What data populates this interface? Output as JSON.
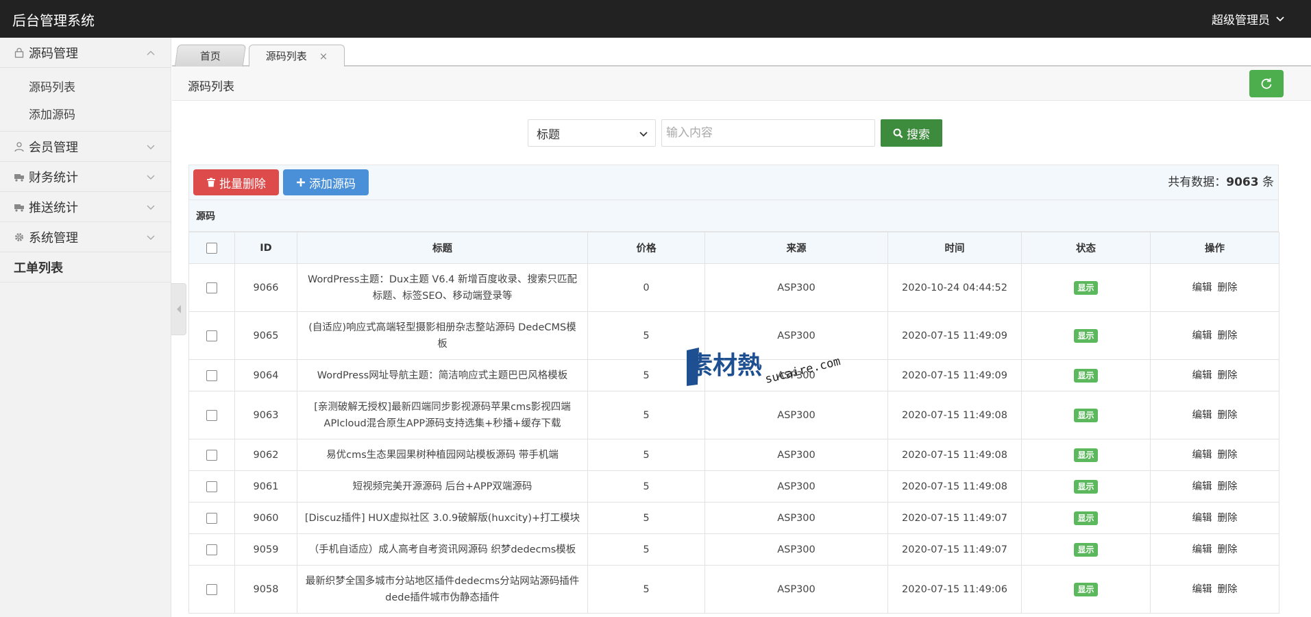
{
  "app": {
    "title": "后台管理系统",
    "user": "超级管理员"
  },
  "sidebar": {
    "groups": [
      {
        "label": "源码管理",
        "icon": "lock-icon",
        "expanded": true,
        "items": [
          "源码列表",
          "添加源码"
        ]
      },
      {
        "label": "会员管理",
        "icon": "user-icon"
      },
      {
        "label": "财务统计",
        "icon": "truck-icon"
      },
      {
        "label": "推送统计",
        "icon": "truck-icon"
      },
      {
        "label": "系统管理",
        "icon": "gear-icon"
      },
      {
        "label": "工单列表"
      }
    ]
  },
  "tabs": {
    "home": "首页",
    "active": "源码列表",
    "close": "×"
  },
  "page": {
    "title": "源码列表"
  },
  "search": {
    "field_selected": "标题",
    "placeholder": "输入内容",
    "button": "搜索"
  },
  "toolbar": {
    "batch_delete": "批量删除",
    "add": "添加源码",
    "total_label": "共有数据：",
    "total_count": "9063",
    "total_unit": " 条"
  },
  "table": {
    "panel_title": "源码",
    "headers": [
      "ID",
      "标题",
      "价格",
      "来源",
      "时间",
      "状态",
      "操作"
    ],
    "edit": "编辑",
    "delete": "删除",
    "rows": [
      {
        "id": "9066",
        "title": "WordPress主题：Dux主题 V6.4 新增百度收录、搜索只匹配标题、标签SEO、移动端登录等",
        "price": "0",
        "source": "ASP300",
        "time": "2020-10-24 04:44:52",
        "status": "显示"
      },
      {
        "id": "9065",
        "title": "(自适应)响应式高端轻型摄影相册杂志整站源码 DedeCMS模板",
        "price": "5",
        "source": "ASP300",
        "time": "2020-07-15 11:49:09",
        "status": "显示"
      },
      {
        "id": "9064",
        "title": "WordPress网址导航主题：简洁响应式主题巴巴风格模板",
        "price": "5",
        "source": "ASP300",
        "time": "2020-07-15 11:49:09",
        "status": "显示"
      },
      {
        "id": "9063",
        "title": "[亲测破解无授权]最新四端同步影视源码苹果cms影视四端APIcloud混合原生APP源码支持选集+秒播+缓存下载",
        "price": "5",
        "source": "ASP300",
        "time": "2020-07-15 11:49:08",
        "status": "显示"
      },
      {
        "id": "9062",
        "title": "易优cms生态果园果树种植园网站模板源码 带手机端",
        "price": "5",
        "source": "ASP300",
        "time": "2020-07-15 11:49:08",
        "status": "显示"
      },
      {
        "id": "9061",
        "title": "短视频完美开源源码 后台+APP双端源码",
        "price": "5",
        "source": "ASP300",
        "time": "2020-07-15 11:49:08",
        "status": "显示"
      },
      {
        "id": "9060",
        "title": "[Discuz插件] HUX虚拟社区 3.0.9破解版(huxcity)+打工模块",
        "price": "5",
        "source": "ASP300",
        "time": "2020-07-15 11:49:07",
        "status": "显示"
      },
      {
        "id": "9059",
        "title": "（手机自适应）成人高考自考资讯网源码 织梦dedecms模板",
        "price": "5",
        "source": "ASP300",
        "time": "2020-07-15 11:49:07",
        "status": "显示"
      },
      {
        "id": "9058",
        "title": "最新织梦全国多城市分站地区插件dedecms分站网站源码插件dede插件城市伪静态插件",
        "price": "5",
        "source": "ASP300",
        "time": "2020-07-15 11:49:06",
        "status": "显示"
      }
    ]
  },
  "watermark": {
    "brand": "素材熱",
    "domain": "sucaire.com"
  },
  "colors": {
    "topbar": "#222222",
    "success": "#4cae4c",
    "danger": "#dd4b4b",
    "primary": "#4a90d9"
  }
}
